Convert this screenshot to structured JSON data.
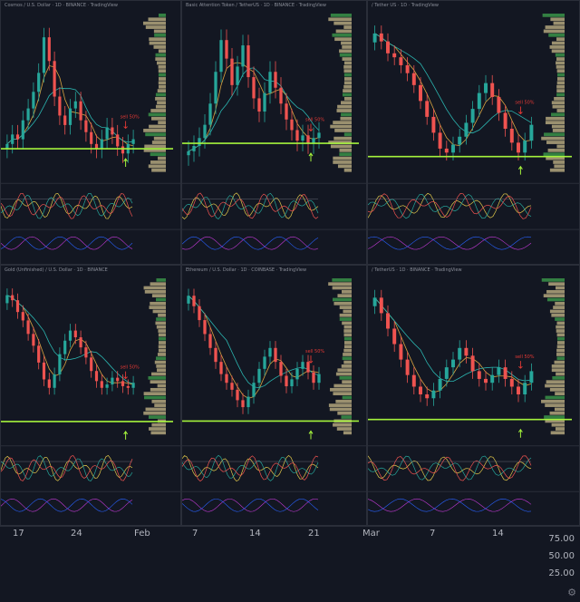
{
  "colors": {
    "up": "#26a69a",
    "down": "#ef5350",
    "support": "#a4f33c",
    "ma_fast": "#d9a441",
    "ma_slow": "#2bb5b0",
    "ma_long": "#c23ad6",
    "annotation": "#e53935",
    "arrow_up": "#a4f33c",
    "volume_profile": "#c8b98a"
  },
  "panels": [
    {
      "header": "Cosmos / U.S. Dollar · 1D · BINANCE · TradingView",
      "annotation": "sell 50%"
    },
    {
      "header": "Basic Attention Token / TetherUS · 1D · BINANCE · TradingView",
      "annotation": "sell 50%"
    },
    {
      "header": "/ Tether US · 1D · TradingView",
      "annotation": "sell 50%"
    },
    {
      "header": "Gold (Unfinished) / U.S. Dollar · 1D · BINANCE",
      "annotation": "sell 50%"
    },
    {
      "header": "Ethereum / U.S. Dollar · 1D · COINBASE · TradingView",
      "annotation": "sell 50%"
    },
    {
      "header": "/ TetherUS · 1D · BINANCE · TradingView",
      "annotation": "sell 50%"
    }
  ],
  "bottom_axis": {
    "x_ticks": [
      "17",
      "24",
      "Feb",
      "7",
      "14",
      "21",
      "Mar",
      "7",
      "14"
    ],
    "y_ticks": [
      "75.00",
      "50.00",
      "25.00"
    ]
  },
  "chart_data": [
    {
      "type": "candlestick",
      "series": [
        {
          "name": "close",
          "values": [
            40,
            44,
            42,
            50,
            55,
            62,
            70,
            85,
            75,
            60,
            52,
            48,
            55,
            58,
            50,
            45,
            40,
            38,
            42,
            47,
            44,
            39,
            36,
            40,
            42
          ]
        }
      ],
      "support": 38
    },
    {
      "type": "candlestick",
      "series": [
        {
          "name": "close",
          "values": [
            30,
            32,
            35,
            40,
            48,
            60,
            72,
            65,
            55,
            62,
            70,
            58,
            50,
            45,
            52,
            60,
            54,
            48,
            42,
            38,
            34,
            36,
            33,
            35,
            37
          ]
        }
      ],
      "support": 33
    },
    {
      "type": "candlestick",
      "series": [
        {
          "name": "close",
          "values": [
            90,
            86,
            80,
            78,
            74,
            70,
            64,
            56,
            48,
            40,
            32,
            30,
            34,
            38,
            45,
            52,
            60,
            65,
            58,
            50,
            42,
            35,
            30,
            36,
            44
          ]
        }
      ],
      "support": 28
    },
    {
      "type": "candlestick",
      "series": [
        {
          "name": "close",
          "values": [
            95,
            92,
            85,
            80,
            72,
            65,
            55,
            45,
            40,
            48,
            60,
            68,
            74,
            70,
            64,
            58,
            50,
            44,
            40,
            42,
            46,
            44,
            41,
            40,
            43
          ]
        }
      ],
      "support": 20
    },
    {
      "type": "candlestick",
      "series": [
        {
          "name": "close",
          "values": [
            90,
            84,
            76,
            68,
            60,
            52,
            45,
            40,
            36,
            30,
            26,
            32,
            40,
            48,
            55,
            60,
            52,
            44,
            38,
            42,
            48,
            52,
            46,
            40,
            45
          ]
        }
      ],
      "support": 18
    },
    {
      "type": "candlestick",
      "series": [
        {
          "name": "close",
          "values": [
            88,
            80,
            72,
            64,
            56,
            48,
            42,
            38,
            36,
            40,
            46,
            52,
            56,
            62,
            58,
            50,
            46,
            44,
            48,
            52,
            46,
            42,
            38,
            44,
            50
          ]
        }
      ],
      "support": 25
    }
  ]
}
